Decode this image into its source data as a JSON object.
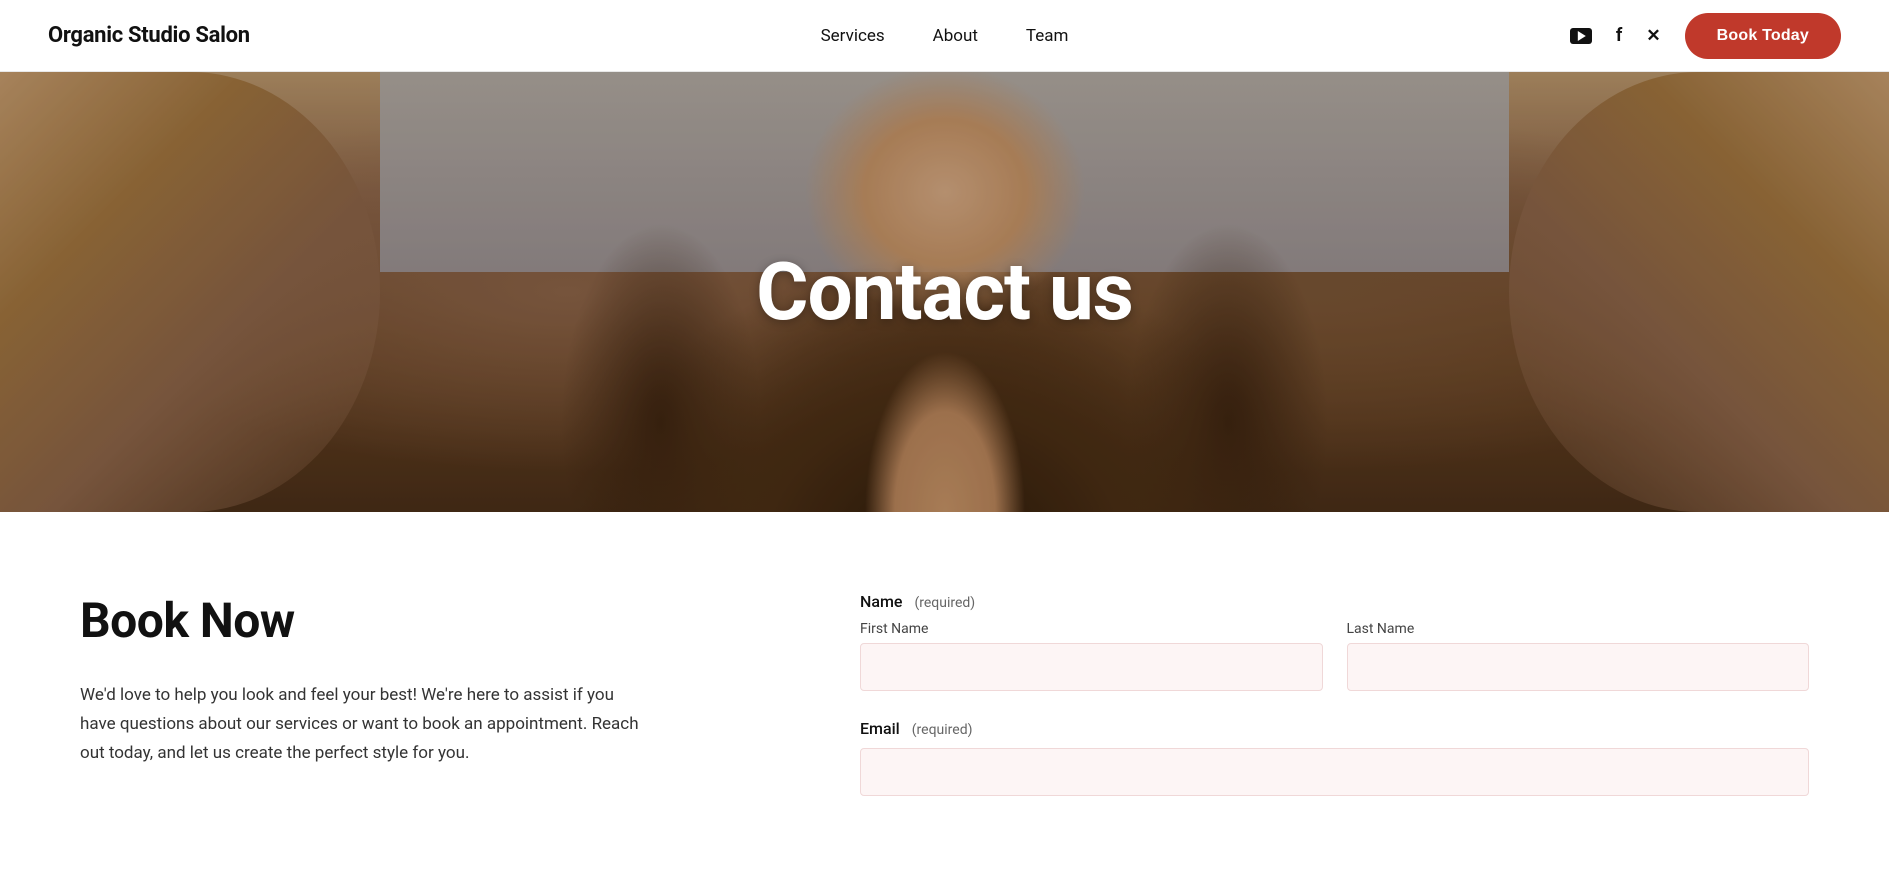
{
  "navbar": {
    "logo": "Organic Studio Salon",
    "nav_items": [
      {
        "label": "Services",
        "href": "#services"
      },
      {
        "label": "About",
        "href": "#about"
      },
      {
        "label": "Team",
        "href": "#team"
      }
    ],
    "book_button": "Book Today"
  },
  "hero": {
    "title": "Contact us"
  },
  "content": {
    "left": {
      "heading": "Book Now",
      "body": "We'd love to help you look and feel your best! We're here to assist if you have questions about our services or want to book an appointment. Reach out today, and let us create the perfect style for you."
    },
    "form": {
      "name_label": "Name",
      "name_required": "(required)",
      "first_name_label": "First Name",
      "last_name_label": "Last Name",
      "email_label": "Email",
      "email_required": "(required)"
    }
  }
}
